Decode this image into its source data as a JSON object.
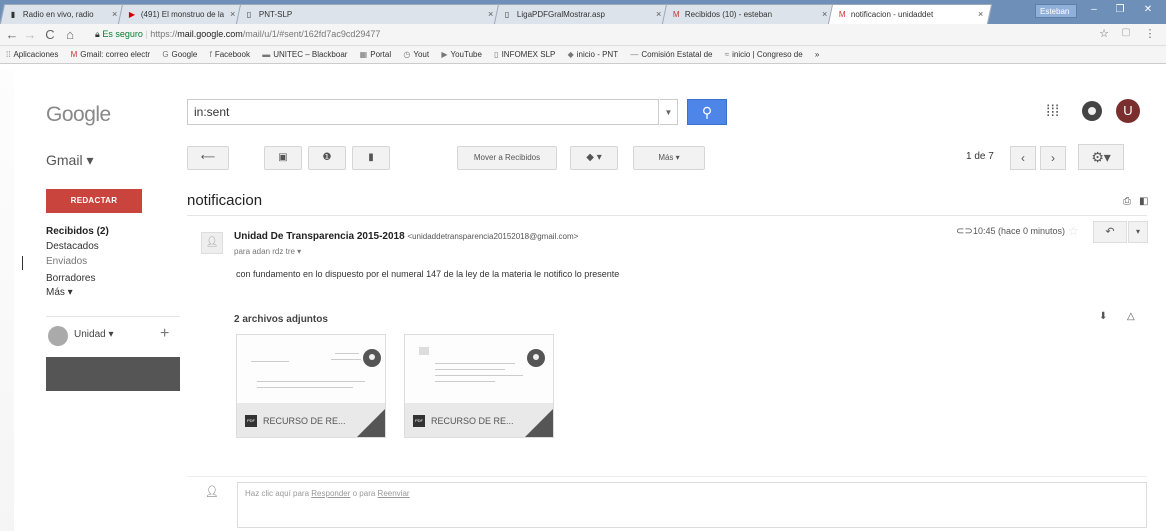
{
  "browser": {
    "tabs": [
      {
        "label": "Radio en vivo, radio",
        "icon": "radio-icon"
      },
      {
        "label": "(491) El monstruo de la",
        "icon": "youtube-icon"
      },
      {
        "label": "PNT-SLP",
        "icon": "page-icon"
      },
      {
        "label": "LigaPDFGralMostrar.asp",
        "icon": "page-icon"
      },
      {
        "label": "Recibidos (10) - esteban",
        "icon": "gmail-icon"
      },
      {
        "label": "notificacion - unidaddet",
        "icon": "gmail-icon",
        "active": true
      }
    ],
    "user_chip": "Esteban",
    "window_buttons": [
      "–",
      "❐",
      "✕"
    ],
    "address": {
      "secure_label": "Es seguro",
      "url_scheme": "https://",
      "url_host": "mail.google.com",
      "url_path": "/mail/u/1/#sent/162fd7ac9cd29477"
    },
    "bookmarks": [
      "Aplicaciones",
      "Gmail: correo electr",
      "Google",
      "Facebook",
      "UNITEC – Blackboar",
      "Portal",
      "Yout",
      "YouTube",
      "INFOMEX SLP",
      "inicio - PNT",
      "Comisión Estatal de",
      "inicio | Congreso de",
      "»"
    ]
  },
  "gmail": {
    "logo": "Google",
    "search_value": "in:sent",
    "account_initial": "U",
    "app_label": "Gmail ▾",
    "toolbar": {
      "move_label": "Mover a Recibidos",
      "more_label": "Más ▾",
      "pager": "1 de 7"
    },
    "sidebar": {
      "compose": "REDACTAR",
      "inbox": "Recibidos (2)",
      "starred": "Destacados",
      "sent": "Enviados",
      "drafts": "Borradores",
      "more": "Más ▾",
      "hangout_name": "Unidad ▾",
      "hangout_add": "+"
    },
    "message": {
      "subject": "notificacion",
      "sender_name": "Unidad De Transparencia 2015-2018",
      "sender_email": "<unidaddetransparencia20152018@gmail.com>",
      "recipient": "para adan rdz tre ▾",
      "time": "10:45 (hace 0 minutos)",
      "body": "con fundamento en lo dispuesto por el numeral 147 de la ley de la materia  le notifico lo presente",
      "attachments_heading": "2 archivos adjuntos",
      "attachments": [
        {
          "name": "RECURSO DE RE...",
          "type": "PDF"
        },
        {
          "name": "RECURSO DE RE...",
          "type": "PDF"
        }
      ]
    },
    "reply": {
      "prefix": "Haz clic aquí para ",
      "reply_link": "Responder",
      "middle": " o para ",
      "forward_link": "Reenviar"
    }
  }
}
